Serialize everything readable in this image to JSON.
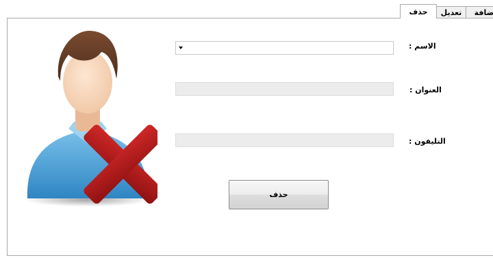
{
  "tabs": [
    {
      "label": "حذف",
      "active": true
    },
    {
      "label": "تعديل",
      "active": false
    },
    {
      "label": "إضافة",
      "active": false
    }
  ],
  "form": {
    "name_label": "الاسم :",
    "address_label": "العنوان :",
    "phone_label": "التليفون :",
    "name_value": "",
    "address_value": "",
    "phone_value": ""
  },
  "delete_button": {
    "label": "حذف"
  },
  "illustration": {
    "icon": "user-delete-icon",
    "accent_color": "#b01818"
  }
}
